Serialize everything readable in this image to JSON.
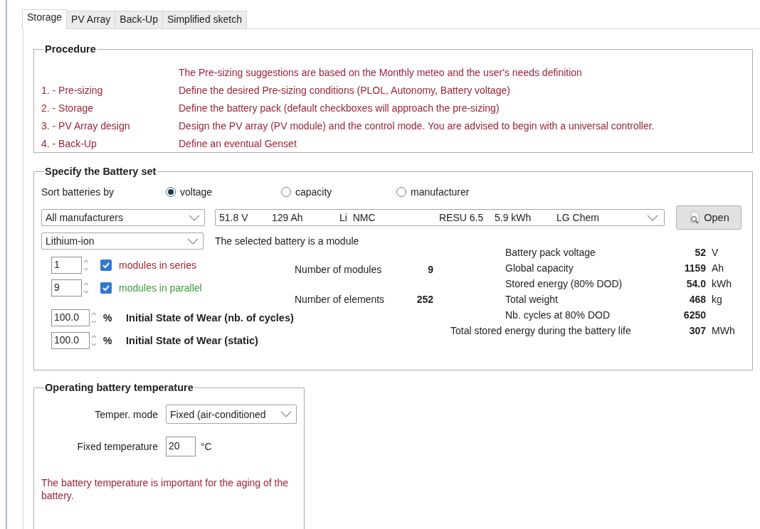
{
  "tabs": [
    {
      "label": "Storage",
      "selected": true
    },
    {
      "label": "PV Array",
      "selected": false
    },
    {
      "label": "Back-Up",
      "selected": false
    },
    {
      "label": "Simplified sketch",
      "selected": false
    }
  ],
  "procedure": {
    "title": "Procedure",
    "intro": "The Pre-sizing suggestions are based on the Monthly meteo and the user's needs definition",
    "steps": [
      {
        "label": "1. - Pre-sizing",
        "text": "Define the desired Pre-sizing conditions (PLOL, Autonomy, Battery voltage)"
      },
      {
        "label": "2. - Storage",
        "text": "Define the battery pack (default checkboxes will approach the pre-sizing)"
      },
      {
        "label": "3. - PV Array design",
        "text": "Design the PV array (PV module) and the control mode. You are advised to begin with a universal controller."
      },
      {
        "label": "4. - Back-Up",
        "text": "Define an eventual Genset"
      }
    ]
  },
  "battery_set": {
    "title": "Specify the Battery set",
    "sort_label": "Sort batteries by",
    "sort_options": [
      {
        "label": "voltage",
        "selected": true
      },
      {
        "label": "capacity",
        "selected": false
      },
      {
        "label": "manufacturer",
        "selected": false
      }
    ],
    "manufacturer_select": "All manufacturers",
    "battery_select": [
      "51.8 V",
      "129 Ah",
      "Li  NMC",
      "RESU 6.5",
      "5.9 kWh",
      "LG Chem"
    ],
    "open_button": "Open",
    "technology_select": "Lithium-ion",
    "module_note": "The selected battery is a module",
    "modules": [
      {
        "value": "1",
        "checked": true,
        "label": "modules in series",
        "color": "#a3262e"
      },
      {
        "value": "9",
        "checked": true,
        "label": "modules in parallel",
        "color": "#3a9a3a"
      }
    ],
    "counts": [
      {
        "label": "Number of modules",
        "value": "9"
      },
      {
        "label": "Number of elements",
        "value": "252"
      }
    ],
    "wear": [
      {
        "value": "100.0",
        "unit": "%",
        "label": "Initial State of Wear (nb. of cycles)"
      },
      {
        "value": "100.0",
        "unit": "%",
        "label": "Initial State of Wear (static)"
      }
    ],
    "stats": [
      {
        "kind": "normal",
        "label": "Battery pack voltage",
        "value": "52",
        "unit": "V"
      },
      {
        "kind": "normal",
        "label": "Global capacity",
        "value": "1159",
        "unit": "Ah"
      },
      {
        "kind": "normal",
        "label": "Stored energy (80% DOD)",
        "value": "54.0",
        "unit": "kWh"
      },
      {
        "kind": "normal",
        "label": "Total weight",
        "value": "468",
        "unit": "kg"
      },
      {
        "kind": "normal",
        "label": "Nb. cycles at 80% DOD",
        "value": "6250"
      },
      {
        "kind": "wide",
        "label": "Total stored energy during the battery life",
        "value": "307",
        "unit": "MWh"
      }
    ]
  },
  "temperature": {
    "title": "Operating battery temperature",
    "mode_label": "Temper. mode",
    "mode_value": "Fixed (air-conditioned",
    "fixed_label": "Fixed temperature",
    "fixed_value": "20",
    "fixed_unit": "°C",
    "note": "The battery temperature is important for the aging of the battery."
  }
}
